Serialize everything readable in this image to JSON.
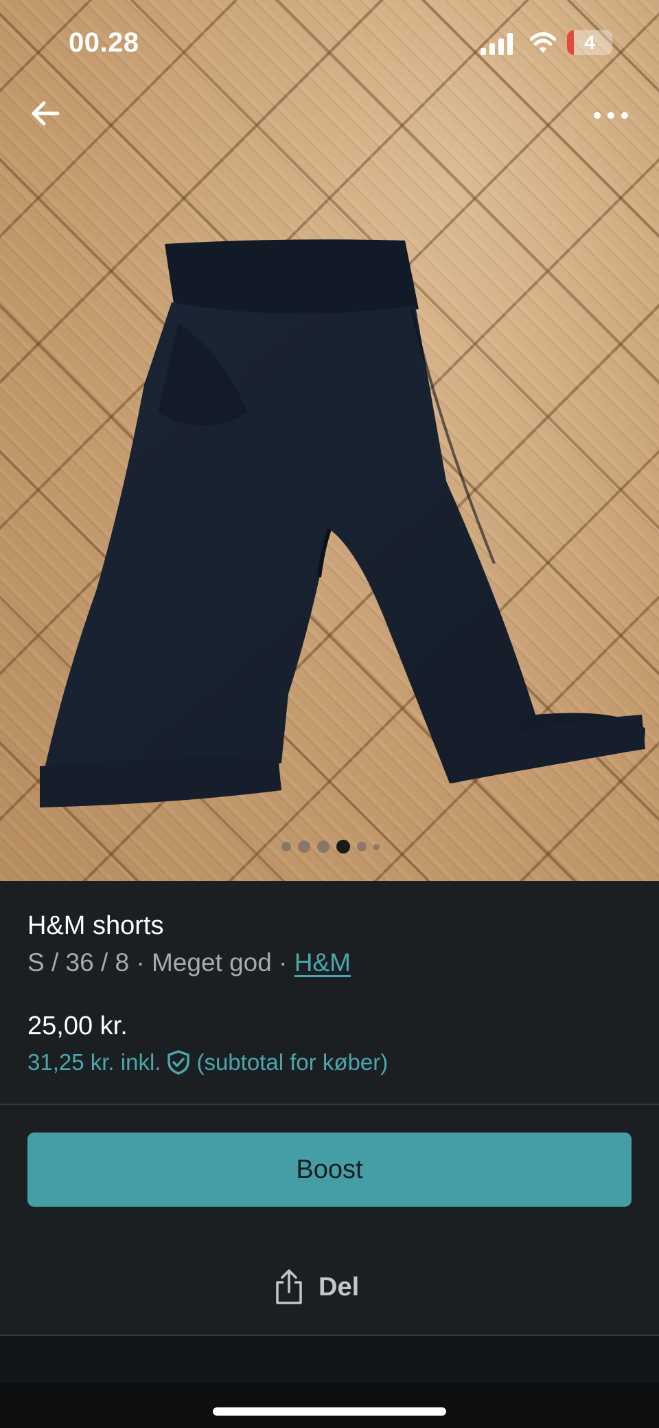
{
  "status_bar": {
    "time": "00.28",
    "battery": "4",
    "icons": [
      "signal-icon",
      "wifi-icon",
      "battery-icon"
    ]
  },
  "toolbar": {
    "back_icon": "arrow-left-icon",
    "more_icon": "more-horizontal-icon"
  },
  "gallery": {
    "image_count": 6,
    "active_index": 3
  },
  "listing": {
    "title": "H&M shorts",
    "size_condition": "S / 36 / 8 · Meget god · ",
    "brand": "H&M",
    "price": "25,00 kr.",
    "buyer_price": "31,25 kr. inkl.",
    "buyer_price_note": "(subtotal for køber)",
    "protection_icon": "shield-check-icon"
  },
  "actions": {
    "boost_label": "Boost",
    "share_label": "Del",
    "share_icon": "share-icon"
  },
  "colors": {
    "accent": "#459ea6",
    "link": "#4aa7ad",
    "background": "#1b1f21",
    "muted_text": "#a7abad"
  }
}
